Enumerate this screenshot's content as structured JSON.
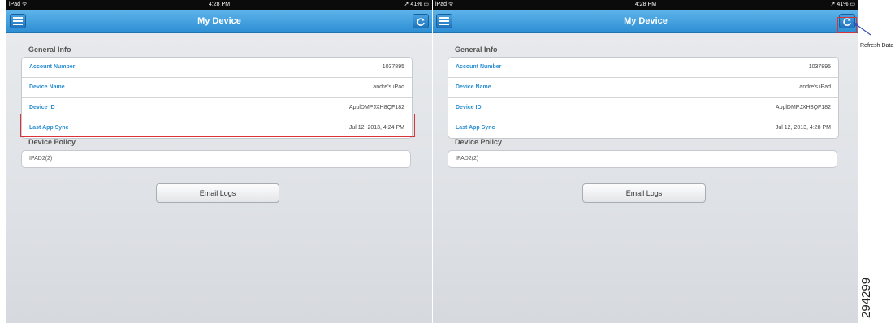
{
  "screens": [
    {
      "status_bar": {
        "carrier": "iPad ᯤ",
        "time": "4:28 PM",
        "battery": "➚ 41% ▭"
      },
      "nav_title": "My Device",
      "general_info_label": "General Info",
      "rows": [
        {
          "label": "Account Number",
          "value": "1037895"
        },
        {
          "label": "Device Name",
          "value": "andre's iPad"
        },
        {
          "label": "Device ID",
          "value": "ApplDMPJXH8QF182"
        },
        {
          "label": "Last App Sync",
          "value": "Jul 12, 2013, 4:24 PM"
        }
      ],
      "device_policy_label": "Device Policy",
      "device_policy_value": "IPAD2(2)",
      "email_logs_label": "Email Logs"
    },
    {
      "status_bar": {
        "carrier": "iPad ᯤ",
        "time": "4:28 PM",
        "battery": "➚ 41% ▭"
      },
      "nav_title": "My Device",
      "general_info_label": "General Info",
      "rows": [
        {
          "label": "Account Number",
          "value": "1037895"
        },
        {
          "label": "Device Name",
          "value": "andre's iPad"
        },
        {
          "label": "Device ID",
          "value": "ApplDMPJXH8QF182"
        },
        {
          "label": "Last App Sync",
          "value": "Jul 12, 2013, 4:28 PM"
        }
      ],
      "device_policy_label": "Device Policy",
      "device_policy_value": "IPAD2(2)",
      "email_logs_label": "Email Logs"
    }
  ],
  "callout": {
    "text": "Refresh Data"
  },
  "figure_number": "294299",
  "icons": {
    "menu": "menu-icon",
    "refresh": "refresh-icon",
    "arrow": "arrow-icon"
  },
  "colors": {
    "nav_blue": "#2d8ed3",
    "label_blue": "#2b8ed1",
    "highlight_red": "#d9333a"
  }
}
